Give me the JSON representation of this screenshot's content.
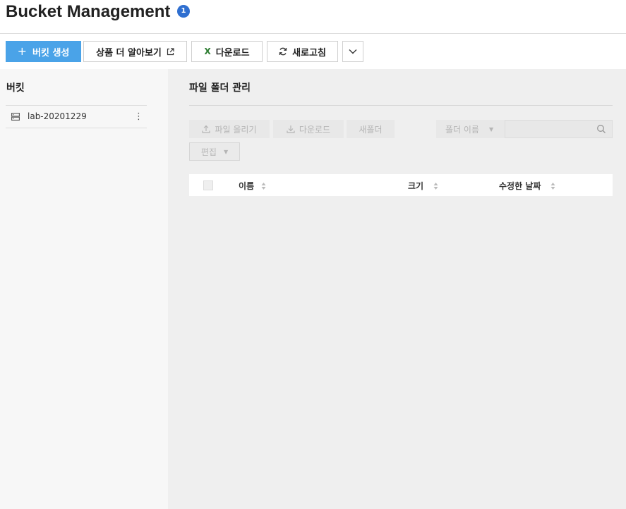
{
  "header": {
    "title": "Bucket Management",
    "info_badge": "1"
  },
  "toolbar": {
    "create_bucket": "버킷 생성",
    "learn_more": "상품 더 알아보기",
    "download": "다운로드",
    "refresh": "새로고침"
  },
  "sidebar": {
    "title": "버킷",
    "buckets": [
      {
        "name": "lab-20201229"
      }
    ]
  },
  "main": {
    "title": "파일 폴더 관리",
    "actions": {
      "upload": "파일 올리기",
      "download": "다운로드",
      "new_folder": "새폴더",
      "edit": "편집"
    },
    "search": {
      "filter_selected": "폴더 이름",
      "placeholder": ""
    },
    "table": {
      "columns": {
        "name": "이름",
        "size": "크기",
        "modified": "수정한 날짜"
      },
      "rows": []
    }
  },
  "colors": {
    "primary": "#4aa3e8",
    "badge": "#2f6fd0",
    "excel": "#2e7d32"
  }
}
